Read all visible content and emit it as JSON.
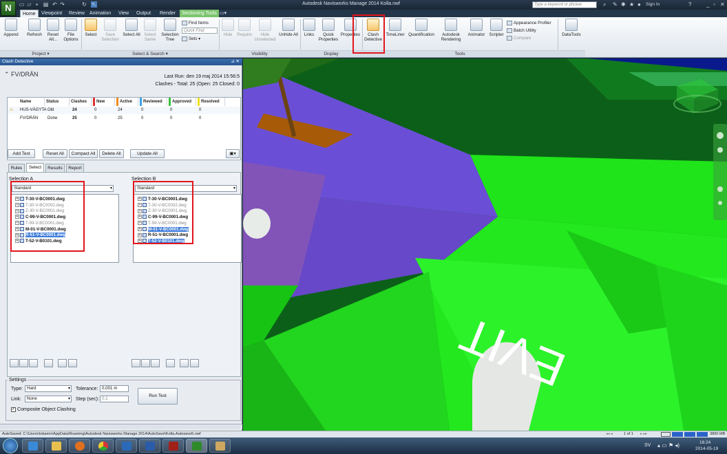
{
  "window": {
    "title": "Autodesk Navisworks Manage 2014    Kolla.nwf",
    "search_placeholder": "Type a keyword or phrase",
    "sign_in": "Sign In"
  },
  "tabs": [
    "Home",
    "Viewpoint",
    "Review",
    "Animation",
    "View",
    "Output",
    "Render",
    "Sectioning Tools"
  ],
  "ribbon": {
    "project": {
      "label": "Project",
      "buttons": [
        "Append",
        "Refresh",
        "Reset All...",
        "File Options"
      ]
    },
    "select_search": {
      "label": "Select & Search",
      "buttons": [
        "Select",
        "Save Selection",
        "Select All",
        "Select Same",
        "Selection Tree"
      ],
      "find_items": "Find Items",
      "quick_find": "Quick Find",
      "sets": "Sets"
    },
    "visibility": {
      "label": "Visibility",
      "buttons": [
        "Hide",
        "Require",
        "Hide Unselected",
        "Unhide All"
      ]
    },
    "display": {
      "label": "Display",
      "buttons": [
        "Links",
        "Quick Properties",
        "Properties"
      ]
    },
    "tools": {
      "label": "Tools",
      "buttons": [
        "Clash Detective",
        "TimeLiner",
        "Quantification",
        "Autodesk Rendering",
        "Animator",
        "Scripter"
      ],
      "appearance_profiler": "Appearance Profiler",
      "batch_utility": "Batch Utility",
      "compare": "Compare"
    },
    "datatools": "DataTools"
  },
  "clash": {
    "panel_title": "Clash Detective",
    "test_name": "FV/DRÄN",
    "last_run": "Last Run:  den 19 maj 2014 15:56:5",
    "summary": "Clashes - Total: 25  (Open: 25  Closed: 0",
    "columns": [
      "Name",
      "Status",
      "Clashes",
      "New",
      "Active",
      "Reviewed",
      "Approved",
      "Resolved"
    ],
    "rows": [
      {
        "name": "HUS-VÄGYTA",
        "status": "Old",
        "clashes": "24",
        "new": "0",
        "active": "24",
        "reviewed": "0",
        "approved": "0",
        "resolved": "0",
        "warn": true
      },
      {
        "name": "FV/DRÄN",
        "status": "Done",
        "clashes": "25",
        "new": "0",
        "active": "25",
        "reviewed": "0",
        "approved": "0",
        "resolved": "0",
        "warn": false
      }
    ],
    "buttons": {
      "add_test": "Add Test",
      "reset_all": "Reset All",
      "compact_all": "Compact All",
      "delete_all": "Delete All",
      "update_all": "Update All"
    },
    "subtabs": [
      "Rules",
      "Select",
      "Results",
      "Report"
    ],
    "selection_a": {
      "label": "Selection A",
      "mode": "Standard",
      "items": [
        {
          "text": "T-30-V-BC0001.dwg",
          "dim": false,
          "hl": false
        },
        {
          "text": "T-30-V-BC0002.dwg",
          "dim": true,
          "hl": false
        },
        {
          "text": "Z-30-V-BC0001.dwg",
          "dim": true,
          "hl": false
        },
        {
          "text": "C-99-V-BC0001.dwg",
          "dim": false,
          "hl": false
        },
        {
          "text": "T-99-V-BC0001.dwg",
          "dim": true,
          "hl": false
        },
        {
          "text": "M-01-V-BC0001.dwg",
          "dim": false,
          "hl": false
        },
        {
          "text": "R-51-V-BC0001.dwg",
          "dim": false,
          "hl": true
        },
        {
          "text": "T-52-V-B0101.dwg",
          "dim": false,
          "hl": false
        }
      ]
    },
    "selection_b": {
      "label": "Selection B",
      "mode": "Standard",
      "items": [
        {
          "text": "T-30-V-BC0001.dwg",
          "dim": false,
          "hl": false
        },
        {
          "text": "T-30-V-BC0002.dwg",
          "dim": true,
          "hl": false
        },
        {
          "text": "Z-30-V-BC0001.dwg",
          "dim": true,
          "hl": false
        },
        {
          "text": "C-99-V-BC0001.dwg",
          "dim": false,
          "hl": false
        },
        {
          "text": "T-99-V-BC0001.dwg",
          "dim": true,
          "hl": false
        },
        {
          "text": "M-01-V-BC0001.dwg",
          "dim": false,
          "hl": true
        },
        {
          "text": "R-51-V-BC0001.dwg",
          "dim": false,
          "hl": false
        },
        {
          "text": "T-52-V-B0101.dwg",
          "dim": false,
          "hl": true
        }
      ]
    },
    "settings": {
      "label": "Settings",
      "type_label": "Type:",
      "type_value": "Hard",
      "tolerance_label": "Tolerance:",
      "tolerance_value": "0,001 m",
      "link_label": "Link:",
      "link_value": "None",
      "step_label": "Step (sec):",
      "step_value": "0,1",
      "composite": "Composite Object Clashing",
      "run_test": "Run Test"
    }
  },
  "viewport": {
    "ground_text": "EVIT"
  },
  "status": {
    "autosave": "AutoSaved: C:\\Users\\tobamn\\AppData\\Roaming\\Autodesk Navisworks Manage 2014\\AutoSave\\Kolla.Autosave5.nwf",
    "page": "1 of 1",
    "memory": "3890 MB"
  },
  "taskbar": {
    "lang": "SV",
    "time": "16:24",
    "date": "2014-05-19"
  },
  "colors": {
    "accent_red": "#e2151b",
    "highlight": "#3b7bd9",
    "context_tab": "#7cc46e"
  }
}
